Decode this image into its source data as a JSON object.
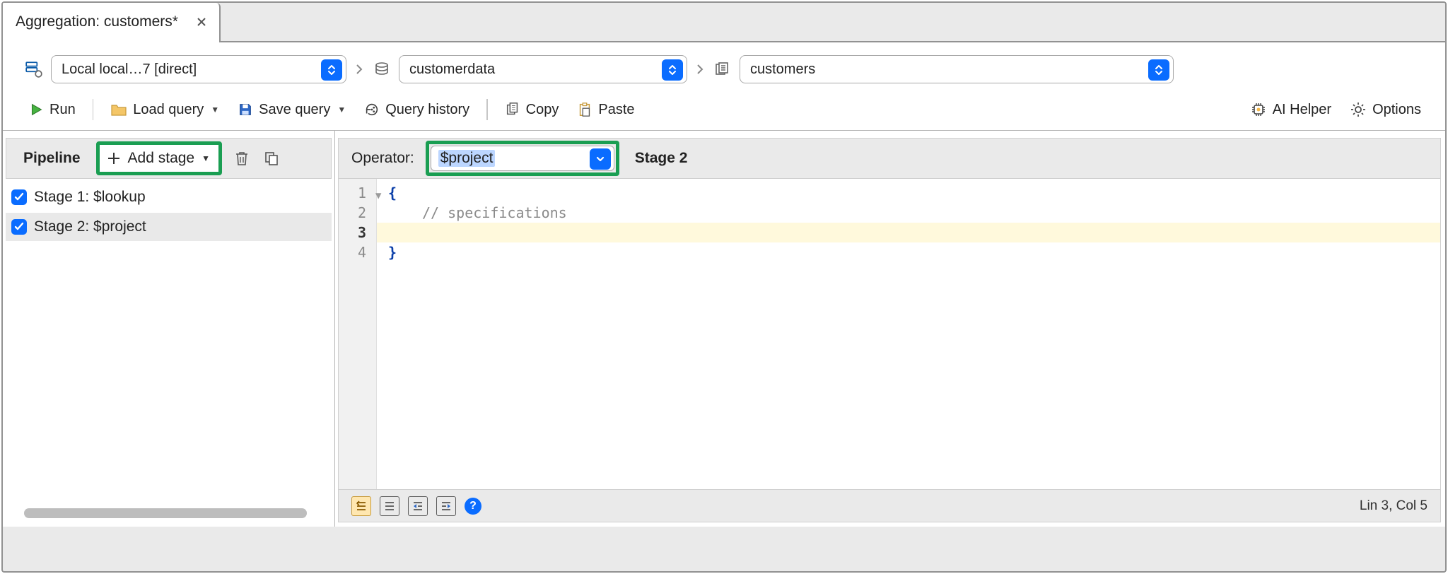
{
  "tab": {
    "title": "Aggregation: customers*"
  },
  "breadcrumb": {
    "connection": "Local local…7 [direct]",
    "database": "customerdata",
    "collection": "customers"
  },
  "toolbar": {
    "run": "Run",
    "load_query": "Load query",
    "save_query": "Save query",
    "query_history": "Query history",
    "copy": "Copy",
    "paste": "Paste",
    "ai_helper": "AI Helper",
    "options": "Options"
  },
  "pipeline": {
    "title": "Pipeline",
    "add_stage": "Add stage",
    "stages": [
      {
        "label": "Stage 1: $lookup",
        "checked": true,
        "selected": false
      },
      {
        "label": "Stage 2: $project",
        "checked": true,
        "selected": true
      }
    ]
  },
  "editor": {
    "operator_label": "Operator:",
    "operator_value": "$project",
    "stage_label": "Stage 2",
    "lines": {
      "l1": "{",
      "l2": "// specifications",
      "l3": "",
      "l4": "}"
    },
    "status": "Lin 3, Col 5",
    "help": "?"
  }
}
